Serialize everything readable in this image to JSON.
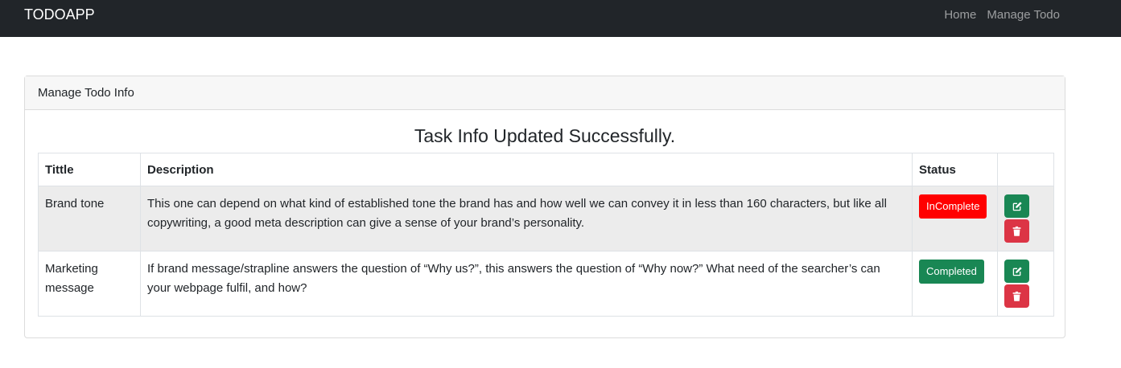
{
  "navbar": {
    "brand": "TODOAPP",
    "links": [
      "Home",
      "Manage Todo"
    ]
  },
  "card": {
    "header": "Manage Todo Info",
    "message": "Task Info Updated Successfully."
  },
  "table": {
    "columns": [
      "Tittle",
      "Description",
      "Status",
      ""
    ],
    "rows": [
      {
        "title": "Brand tone",
        "description": "This one can depend on what kind of established tone the brand has and how well we can convey it in less than 160 characters, but like all copywriting, a good meta description can give a sense of your brand’s personality.",
        "status": "InComplete"
      },
      {
        "title": "Marketing message",
        "description": "If brand message/strapline answers the question of “Why us?”, this answers the question of “Why now?” What need of the searcher’s can your webpage fulfil, and how?",
        "status": "Completed"
      }
    ]
  },
  "colors": {
    "navbar": "#212529",
    "incomplete": "#ff0000",
    "completed": "#198754",
    "delete": "#dc3545"
  },
  "icons": {
    "edit": "edit-icon",
    "delete": "trash-icon"
  }
}
